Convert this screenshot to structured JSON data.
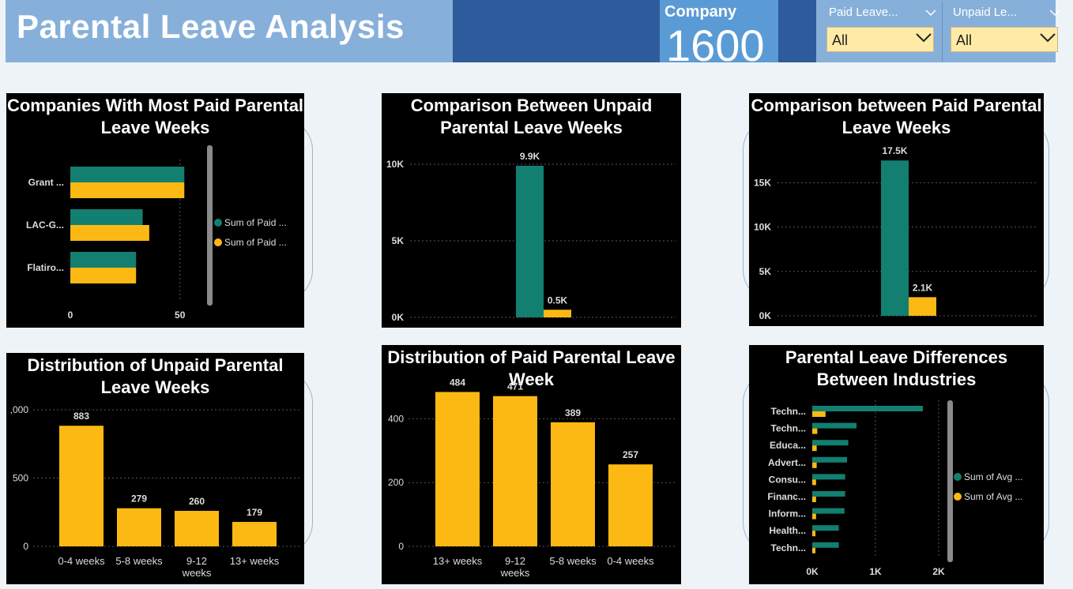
{
  "header": {
    "title": "Parental Leave Analysis",
    "kpi": {
      "label": "Company",
      "value": "1600"
    },
    "slicers": [
      {
        "title": "Paid Leave...",
        "value": "All"
      },
      {
        "title": "Unpaid Le...",
        "value": "All"
      }
    ]
  },
  "colors": {
    "teal": "#127f70",
    "gold": "#fdb913",
    "header": "#86b0da",
    "band": "#2e5b9c",
    "kpi": "#5b9bd5"
  },
  "charts": {
    "top_companies": {
      "title": "Companies With Most Paid Parental Leave Weeks",
      "chart_data": {
        "type": "bar",
        "orientation": "horizontal",
        "categories": [
          "Grant ...",
          "LAC-G...",
          "Flatiro..."
        ],
        "series": [
          {
            "name": "Sum of Paid ...",
            "values": [
              52,
              33,
              30
            ]
          },
          {
            "name": "Sum of Paid ...",
            "values": [
              52,
              36,
              30
            ]
          }
        ],
        "xticks": [
          "0",
          "50"
        ],
        "xlim": [
          0,
          62
        ],
        "legend": "right"
      }
    },
    "unpaid_comparison": {
      "title": "Comparison Between Unpaid Parental Leave Weeks",
      "chart_data": {
        "type": "bar",
        "values": [
          9900,
          500
        ],
        "data_labels": [
          "9.9K",
          "0.5K"
        ],
        "yticks": [
          "0K",
          "5K",
          "10K"
        ],
        "ylim": [
          0,
          10000
        ]
      }
    },
    "paid_comparison": {
      "title": "Comparison between Paid Parental Leave Weeks",
      "chart_data": {
        "type": "bar",
        "values": [
          17500,
          2100
        ],
        "data_labels": [
          "17.5K",
          "2.1K"
        ],
        "yticks": [
          "0K",
          "5K",
          "10K",
          "15K"
        ],
        "ylim": [
          0,
          18500
        ]
      }
    },
    "unpaid_distribution": {
      "title": "Distribution of Unpaid Parental Leave Weeks",
      "chart_data": {
        "type": "bar",
        "categories": [
          "0-4 weeks",
          "5-8 weeks",
          "9-12 weeks",
          "13+ weeks"
        ],
        "values": [
          883,
          279,
          260,
          179
        ],
        "yticks": [
          "0",
          "500",
          ",000"
        ],
        "ylim": [
          0,
          1000
        ]
      }
    },
    "paid_distribution": {
      "title": "Distribution of Paid Parental Leave Week",
      "chart_data": {
        "type": "bar",
        "categories": [
          "13+ weeks",
          "9-12 weeks",
          "5-8 weeks",
          "0-4 weeks"
        ],
        "values": [
          484,
          471,
          389,
          257
        ],
        "yticks": [
          "0",
          "200",
          "400"
        ],
        "ylim": [
          0,
          500
        ]
      }
    },
    "industries": {
      "title": "Parental Leave Differences Between Industries",
      "chart_data": {
        "type": "bar",
        "orientation": "horizontal",
        "categories": [
          "Techn...",
          "Techn...",
          "Educa...",
          "Advert...",
          "Consu...",
          "Financ...",
          "Inform...",
          "Health...",
          "Techn..."
        ],
        "series": [
          {
            "name": "Sum of Avg ...",
            "values": [
              1750,
              700,
              570,
              550,
              520,
              520,
              510,
              420,
              420
            ]
          },
          {
            "name": "Sum of Avg ...",
            "values": [
              210,
              80,
              70,
              70,
              60,
              60,
              60,
              50,
              50
            ]
          }
        ],
        "xticks": [
          "0K",
          "1K",
          "2K"
        ],
        "xlim": [
          0,
          2000
        ],
        "legend": "right"
      }
    }
  }
}
